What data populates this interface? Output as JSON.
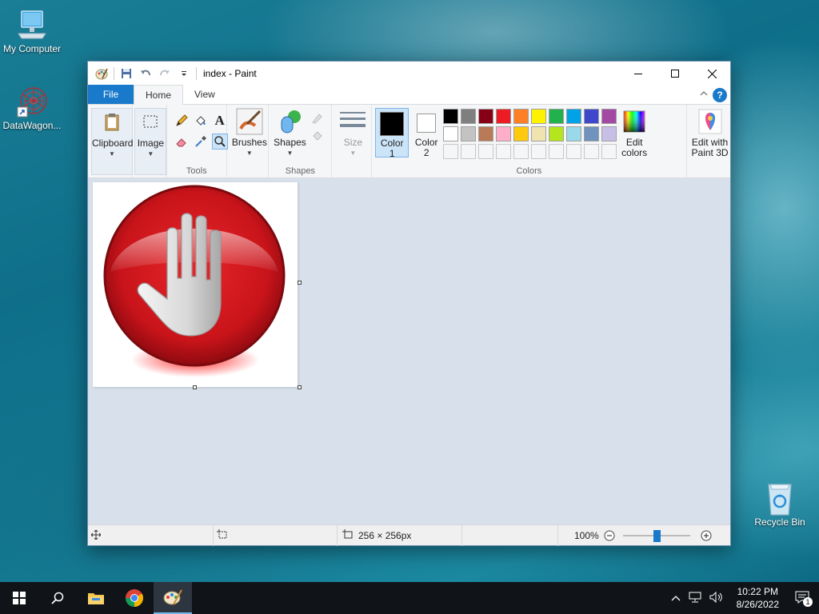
{
  "desktop": {
    "icons": [
      {
        "label": "My Computer",
        "icon": "computer-icon"
      },
      {
        "label": "DataWagon...",
        "icon": "datawagon-shortcut-icon"
      },
      {
        "label": "Recycle Bin",
        "icon": "recycle-bin-icon"
      }
    ]
  },
  "window": {
    "title": "index - Paint",
    "controls": {
      "minimize": "minimize-icon",
      "maximize": "maximize-icon",
      "close": "close-icon"
    }
  },
  "tabs": [
    {
      "label": "File"
    },
    {
      "label": "Home"
    },
    {
      "label": "View"
    }
  ],
  "ribbon": {
    "clipboard": {
      "label": "Clipboard"
    },
    "image": {
      "label": "Image"
    },
    "tools": {
      "group_label": "Tools"
    },
    "brushes": {
      "label": "Brushes"
    },
    "shapes": {
      "label": "Shapes",
      "group_label": "Shapes"
    },
    "size": {
      "label": "Size"
    },
    "color1": {
      "line1": "Color",
      "line2": "1",
      "value": "#000000"
    },
    "color2": {
      "line1": "Color",
      "line2": "2",
      "value": "#ffffff"
    },
    "colors_group_label": "Colors",
    "palette_row1": [
      "#000000",
      "#7f7f7f",
      "#880015",
      "#ed1c24",
      "#ff7f27",
      "#fff200",
      "#22b14c",
      "#00a2e8",
      "#3f48cc",
      "#a349a4"
    ],
    "palette_row2": [
      "#ffffff",
      "#c3c3c3",
      "#b97a57",
      "#ffaec9",
      "#ffc90e",
      "#efe4b0",
      "#b5e61d",
      "#99d9ea",
      "#7092be",
      "#c8bfe7"
    ],
    "edit_colors": {
      "line1": "Edit",
      "line2": "colors"
    },
    "paint3d": {
      "line1": "Edit with",
      "line2": "Paint 3D"
    }
  },
  "canvas": {
    "image": "stop-hand-icon"
  },
  "statusbar": {
    "dimensions": "256 × 256px",
    "zoom": "100%",
    "zoom_level": 0.5
  },
  "taskbar": {
    "time": "10:22 PM",
    "date": "8/26/2022",
    "notifications": "1"
  }
}
